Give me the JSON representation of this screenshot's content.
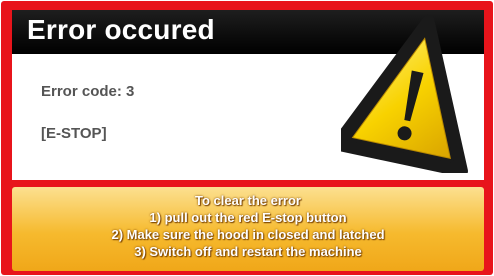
{
  "dialog": {
    "title": "Error occured",
    "error_code": "Error code: 3",
    "error_name": "[E-STOP]",
    "icon": "warning-triangle-icon",
    "instructions": [
      "To clear the error",
      "1) pull out the red E-stop button",
      "2) Make sure the hood in closed and latched",
      "3) Switch off and restart the machine"
    ]
  },
  "colors": {
    "frame": "#e8141b",
    "header": "#000000",
    "warning_yellow": "#f8d200",
    "instructions_panel": "#f6ba2e"
  }
}
